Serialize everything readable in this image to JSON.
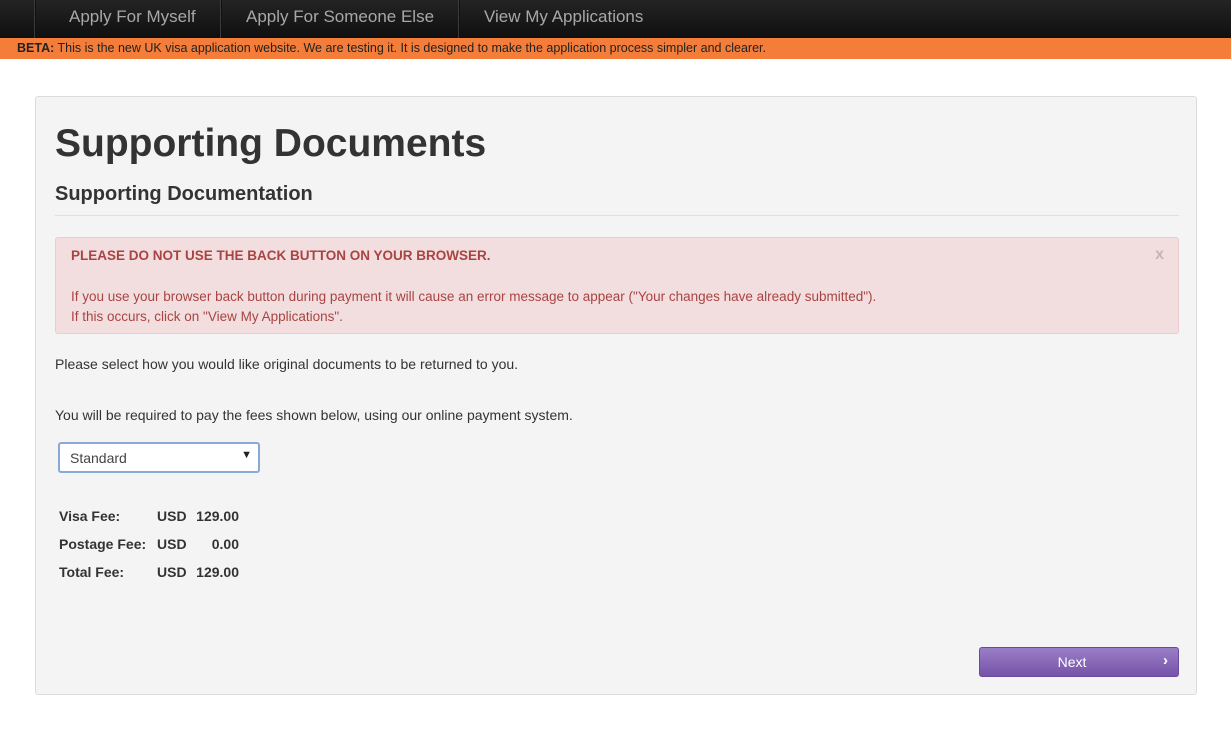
{
  "nav": {
    "items": [
      {
        "label": "Apply For Myself"
      },
      {
        "label": "Apply For Someone Else"
      },
      {
        "label": "View My Applications"
      }
    ]
  },
  "beta": {
    "label": "BETA:",
    "text": " This is the new UK visa application website. We are testing it. It is designed to make the application process simpler and clearer."
  },
  "page": {
    "title": "Supporting Documents",
    "section_title": "Supporting Documentation"
  },
  "alert": {
    "heading": "PLEASE DO NOT USE THE BACK BUTTON ON YOUR BROWSER.",
    "line1": "If you use your browser back button during payment it will cause an error message to appear (\"Your changes have already submitted\").",
    "line2": "If this occurs, click on \"View My Applications\".",
    "close": "x"
  },
  "content": {
    "return_prompt": "Please select how you would like original documents to be returned to you.",
    "fee_notice": "You will be required to pay the fees shown below, using our online payment system."
  },
  "return_method": {
    "selected": "Standard"
  },
  "fees": [
    {
      "label": "Visa Fee:",
      "currency": "USD",
      "amount": "129.00"
    },
    {
      "label": "Postage Fee:",
      "currency": "USD",
      "amount": "0.00"
    },
    {
      "label": "Total Fee:",
      "currency": "USD",
      "amount": "129.00"
    }
  ],
  "actions": {
    "next_label": "Next"
  },
  "colors": {
    "beta_bar": "#f47d3a",
    "alert_text": "#a94442",
    "alert_bg": "#f2dede",
    "next_button": "#7f5fb3"
  }
}
